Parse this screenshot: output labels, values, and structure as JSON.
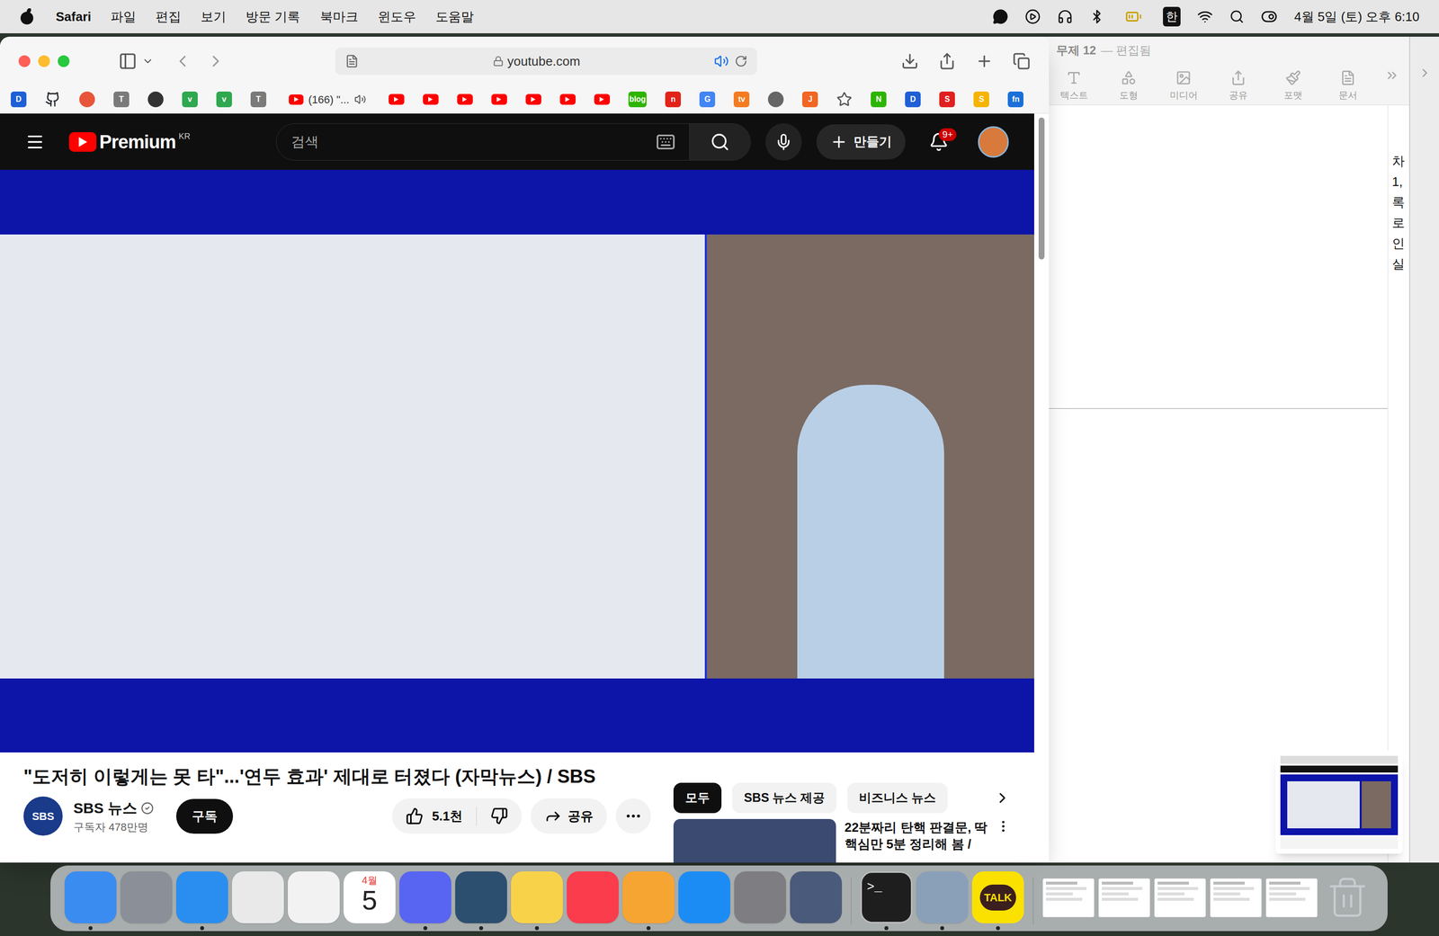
{
  "menubar": {
    "app": "Safari",
    "items": [
      "파일",
      "편집",
      "보기",
      "방문 기록",
      "북마크",
      "윈도우",
      "도움말"
    ],
    "input": "한",
    "clock": "4월 5일 (토) 오후 6:10"
  },
  "safari": {
    "address": "youtube.com",
    "audio_playing": true,
    "favorites": [
      {
        "kind": "letter",
        "label": "D",
        "color": "#1f5fd6"
      },
      {
        "kind": "github",
        "label": "",
        "color": "#24292f"
      },
      {
        "kind": "dot",
        "label": "",
        "color": "#e8553a"
      },
      {
        "kind": "letter",
        "label": "T",
        "color": "#7a7a7a"
      },
      {
        "kind": "dot",
        "label": "",
        "color": "#333333"
      },
      {
        "kind": "letter",
        "label": "v",
        "color": "#2fa84f"
      },
      {
        "kind": "letter",
        "label": "v",
        "color": "#2fa84f"
      },
      {
        "kind": "letter",
        "label": "T",
        "color": "#7a7a7a"
      },
      {
        "kind": "tab",
        "label": "(166) \"...",
        "color": "#ff0000"
      },
      {
        "kind": "youtube",
        "label": "",
        "color": "#ff0000"
      },
      {
        "kind": "youtube",
        "label": "",
        "color": "#ff0000"
      },
      {
        "kind": "youtube",
        "label": "",
        "color": "#ff0000"
      },
      {
        "kind": "youtube",
        "label": "",
        "color": "#ff0000"
      },
      {
        "kind": "youtube",
        "label": "",
        "color": "#ff0000"
      },
      {
        "kind": "youtube",
        "label": "",
        "color": "#ff0000"
      },
      {
        "kind": "youtube",
        "label": "",
        "color": "#ff0000"
      },
      {
        "kind": "letter",
        "label": "blog",
        "color": "#2db400"
      },
      {
        "kind": "letter",
        "label": "n",
        "color": "#e2231a"
      },
      {
        "kind": "letter",
        "label": "G",
        "color": "#4285f4"
      },
      {
        "kind": "letter",
        "label": "tv",
        "color": "#f47b20"
      },
      {
        "kind": "dot",
        "label": "",
        "color": "#666666"
      },
      {
        "kind": "letter",
        "label": "J",
        "color": "#f26522"
      },
      {
        "kind": "star",
        "label": "",
        "color": "#555555"
      },
      {
        "kind": "letter",
        "label": "N",
        "color": "#2db400"
      },
      {
        "kind": "letter",
        "label": "D",
        "color": "#1f5fd6"
      },
      {
        "kind": "letter",
        "label": "S",
        "color": "#e02020"
      },
      {
        "kind": "letter",
        "label": "S",
        "color": "#f5b400"
      },
      {
        "kind": "letter",
        "label": "fn",
        "color": "#1a6fd8"
      }
    ]
  },
  "youtube": {
    "logo": "Premium",
    "region": "KR",
    "search_placeholder": "검색",
    "create": "만들기",
    "notifications": "9+"
  },
  "video": {
    "title": "\"도저히 이렇게는 못 타\"...'연두 효과' 제대로 터졌다 (자막뉴스) / SBS",
    "channel": "SBS 뉴스",
    "channel_avatar": "SBS",
    "verified": true,
    "subscribers": "구독자 478만명",
    "subscribe": "구독",
    "likes": "5.1천",
    "share": "공유"
  },
  "related": {
    "chips": [
      {
        "label": "모두",
        "selected": true
      },
      {
        "label": "SBS 뉴스 제공",
        "selected": false
      },
      {
        "label": "비즈니스 뉴스",
        "selected": false
      }
    ],
    "items": [
      {
        "title_lines": [
          "22분짜리 탄핵 판결문, 딱",
          "핵심만 5분 정리해 봄 /"
        ]
      }
    ]
  },
  "pages": {
    "title": "무제 12",
    "status": "— 편집됨",
    "toolbar": [
      "텍스트",
      "도형",
      "미디어",
      "공유",
      "포맷",
      "문서"
    ],
    "fragments": [
      "차",
      "1,",
      "록",
      "로",
      "인",
      "실"
    ]
  },
  "dock": [
    {
      "kind": "app",
      "label": "",
      "color": "#3b8cf0",
      "running": true
    },
    {
      "kind": "app",
      "label": "",
      "color": "#8a8f98",
      "running": false
    },
    {
      "kind": "app",
      "label": "",
      "color": "#2a8ef0",
      "running": true
    },
    {
      "kind": "app",
      "label": "",
      "color": "#e9e9e9",
      "running": false
    },
    {
      "kind": "app",
      "label": "",
      "color": "#f2f2f2",
      "running": false
    },
    {
      "kind": "calendar",
      "label": "4월",
      "sub": "5",
      "color": "#ffffff",
      "running": false
    },
    {
      "kind": "app",
      "label": "",
      "color": "#5865f2",
      "running": true
    },
    {
      "kind": "app",
      "label": "",
      "color": "#2d4f6f",
      "running": true
    },
    {
      "kind": "app",
      "label": "",
      "color": "#f8d34a",
      "running": true
    },
    {
      "kind": "app",
      "label": "",
      "color": "#fa3c4c",
      "running": false
    },
    {
      "kind": "app",
      "label": "",
      "color": "#f7a532",
      "running": true
    },
    {
      "kind": "app",
      "label": "",
      "color": "#1c8cf5",
      "running": false
    },
    {
      "kind": "app",
      "label": "",
      "color": "#7d7d82",
      "running": false
    },
    {
      "kind": "app",
      "label": "",
      "color": "#4a5a7a",
      "running": false
    },
    {
      "kind": "divider",
      "label": "",
      "color": "#9a9a9a",
      "running": false
    },
    {
      "kind": "terminal",
      "label": ">_",
      "color": "#1e1e1e",
      "running": true
    },
    {
      "kind": "app",
      "label": "",
      "color": "#8aa0b8",
      "running": true
    },
    {
      "kind": "kakao",
      "label": "TALK",
      "color": "#fae100",
      "running": true
    },
    {
      "kind": "divider",
      "label": "",
      "color": "#9a9a9a",
      "running": false
    },
    {
      "kind": "window",
      "label": "",
      "color": "#ffffff",
      "running": false
    },
    {
      "kind": "window",
      "label": "",
      "color": "#ffffff",
      "running": false
    },
    {
      "kind": "window",
      "label": "",
      "color": "#ffffff",
      "running": false
    },
    {
      "kind": "window",
      "label": "",
      "color": "#ffffff",
      "running": false
    },
    {
      "kind": "window",
      "label": "",
      "color": "#ffffff",
      "running": false
    },
    {
      "kind": "trash",
      "label": "",
      "color": "#d9dde1",
      "running": false
    }
  ]
}
